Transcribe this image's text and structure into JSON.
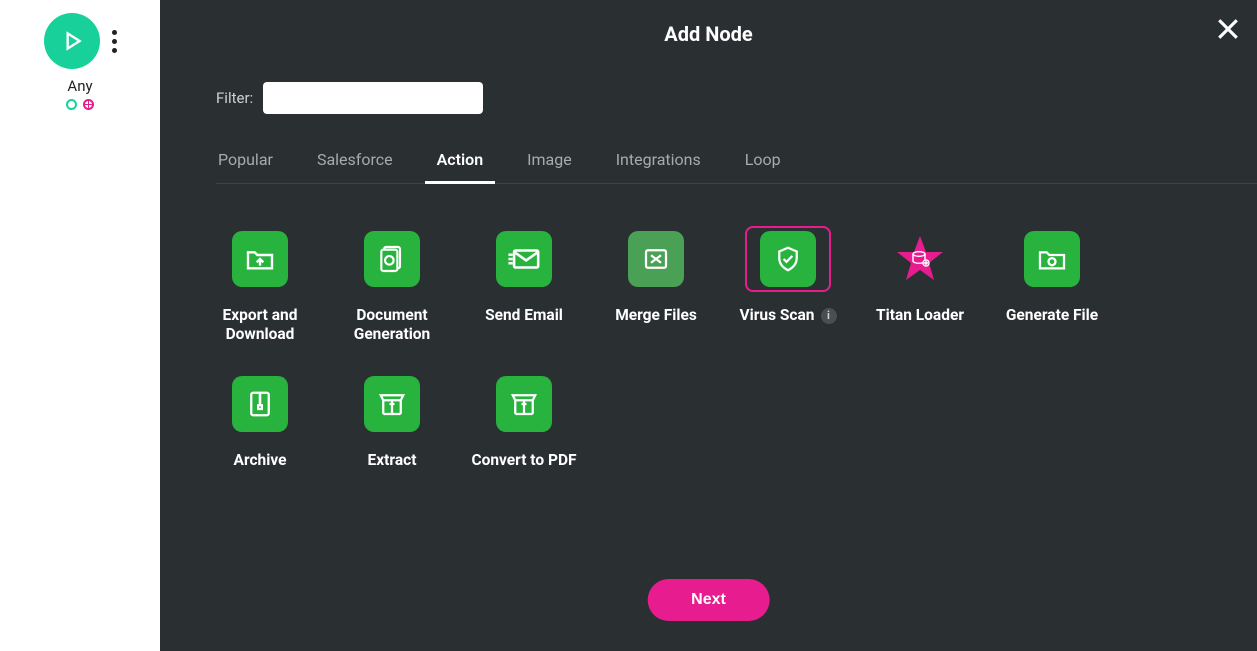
{
  "colors": {
    "accent_green": "#28b33e",
    "accent_teal": "#18d19a",
    "accent_pink": "#e61c8f",
    "panel_bg": "#2a2f32"
  },
  "canvas": {
    "node_label": "Any"
  },
  "modal": {
    "title": "Add Node",
    "filter_label": "Filter:",
    "filter_value": "",
    "tabs": [
      {
        "label": "Popular",
        "active": false
      },
      {
        "label": "Salesforce",
        "active": false
      },
      {
        "label": "Action",
        "active": true
      },
      {
        "label": "Image",
        "active": false
      },
      {
        "label": "Integrations",
        "active": false
      },
      {
        "label": "Loop",
        "active": false
      }
    ],
    "tiles": [
      {
        "label": "Export and Download",
        "icon": "folder-upload-icon",
        "selected": false
      },
      {
        "label": "Document Generation",
        "icon": "doc-gear-icon",
        "selected": false
      },
      {
        "label": "Send Email",
        "icon": "envelope-send-icon",
        "selected": false
      },
      {
        "label": "Merge Files",
        "icon": "merge-icon",
        "selected": false,
        "muted": true
      },
      {
        "label": "Virus Scan",
        "icon": "shield-check-icon",
        "selected": true,
        "info": true
      },
      {
        "label": "Titan Loader",
        "icon": "star-db-icon",
        "selected": false,
        "pink_star": true
      },
      {
        "label": "Generate File",
        "icon": "folder-gear-icon",
        "selected": false
      },
      {
        "label": "Archive",
        "icon": "zip-icon",
        "selected": false
      },
      {
        "label": "Extract",
        "icon": "open-box-icon",
        "selected": false
      },
      {
        "label": "Convert to PDF",
        "icon": "convert-box-icon",
        "selected": false
      }
    ],
    "info_glyph": "i",
    "next_label": "Next"
  }
}
